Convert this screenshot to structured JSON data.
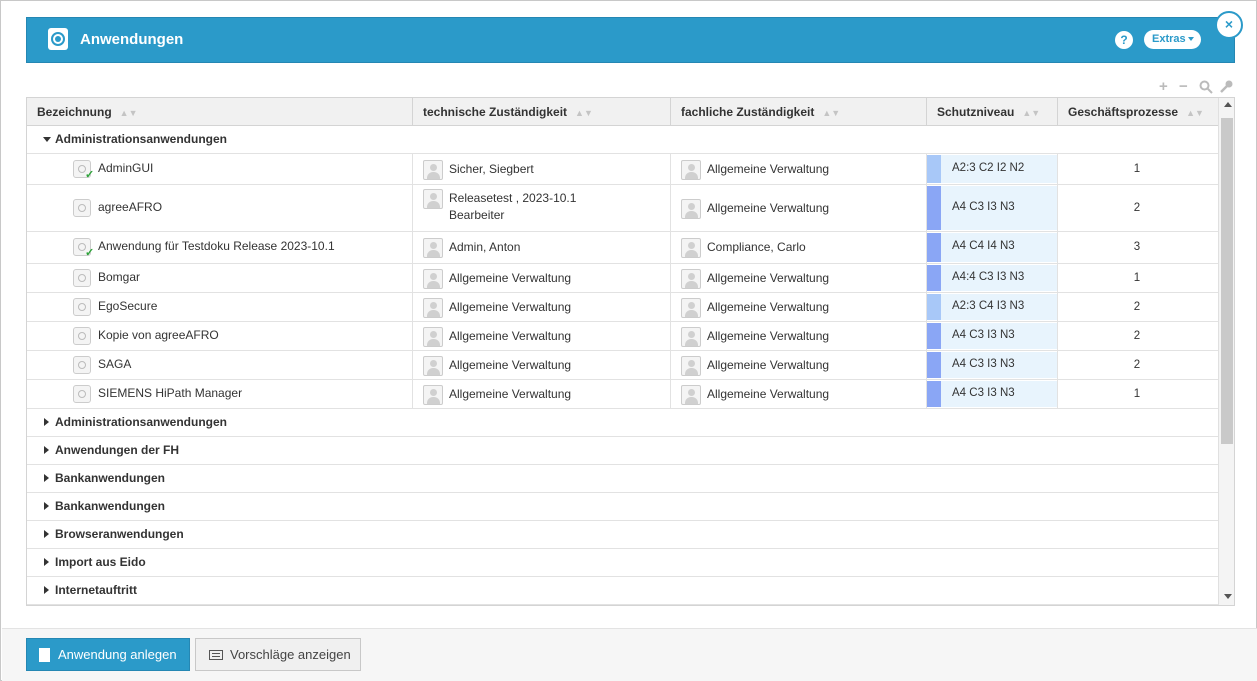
{
  "window": {
    "title": "Anwendungen",
    "help_label": "?",
    "extras_label": "Extras",
    "close_label": "×"
  },
  "toolbar": {
    "expand_label": "+",
    "collapse_label": "−"
  },
  "table": {
    "columns": [
      "Bezeichnung",
      "technische Zuständigkeit",
      "fachliche Zuständigkeit",
      "Schutzniveau",
      "Geschäftsprozesse"
    ],
    "expanded_group": "Administrationsanwendungen",
    "rows": [
      {
        "name": "AdminGUI",
        "tech": "Sicher, Siegbert",
        "tech2": "",
        "fach": "Allgemeine Verwaltung",
        "schutz": "A2:3 C2 I2 N2",
        "proc": "1"
      },
      {
        "name": "agreeAFRO",
        "tech": "Releasetest , 2023-10.1",
        "tech2": "Bearbeiter",
        "fach": "Allgemeine Verwaltung",
        "schutz": "A4 C3 I3 N3",
        "proc": "2"
      },
      {
        "name": "Anwendung für Testdoku Release 2023-10.1",
        "tech": "Admin, Anton",
        "tech2": "",
        "fach": "Compliance, Carlo",
        "schutz": "A4 C4 I4 N3",
        "proc": "3"
      },
      {
        "name": "Bomgar",
        "tech": "Allgemeine Verwaltung",
        "tech2": "",
        "fach": "Allgemeine Verwaltung",
        "schutz": "A4:4 C3 I3 N3",
        "proc": "1"
      },
      {
        "name": "EgoSecure",
        "tech": "Allgemeine Verwaltung",
        "tech2": "",
        "fach": "Allgemeine Verwaltung",
        "schutz": "A2:3 C4 I3 N3",
        "proc": "2"
      },
      {
        "name": "Kopie von agreeAFRO",
        "tech": "Allgemeine Verwaltung",
        "tech2": "",
        "fach": "Allgemeine Verwaltung",
        "schutz": "A4 C3 I3 N3",
        "proc": "2"
      },
      {
        "name": "SAGA",
        "tech": "Allgemeine Verwaltung",
        "tech2": "",
        "fach": "Allgemeine Verwaltung",
        "schutz": "A4 C3 I3 N3",
        "proc": "2"
      },
      {
        "name": "SIEMENS HiPath Manager",
        "tech": "Allgemeine Verwaltung",
        "tech2": "",
        "fach": "Allgemeine Verwaltung",
        "schutz": "A4 C3 I3 N3",
        "proc": "1"
      }
    ],
    "collapsed_groups": [
      "Administrationsanwendungen",
      "Anwendungen der FH",
      "Bankanwendungen",
      "Bankanwendungen",
      "Browseranwendungen",
      "Import aus Eido",
      "Internetauftritt"
    ]
  },
  "footer": {
    "create_label": "Anwendung anlegen",
    "suggest_label": "Vorschläge anzeigen"
  },
  "colors": {
    "accent": "#2b9ac9",
    "schutz_light": "#a8c8f8",
    "schutz_dark": "#8aa6f5",
    "check": "#2ea33a"
  }
}
